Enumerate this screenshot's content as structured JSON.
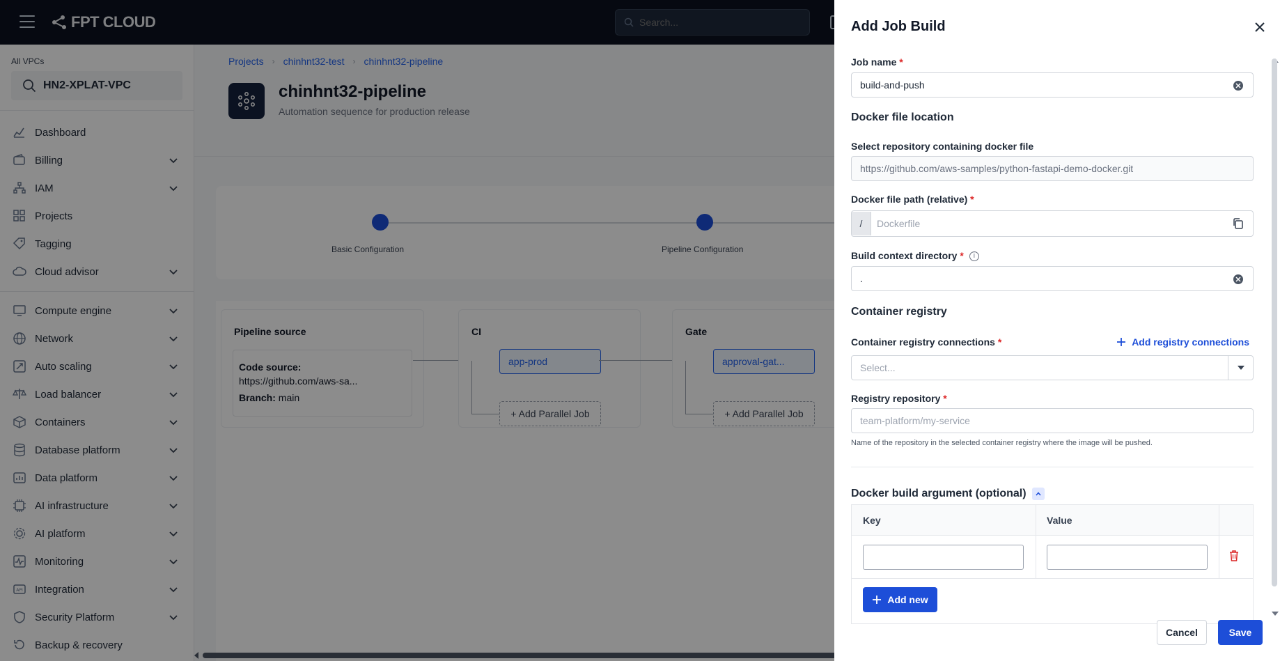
{
  "topbar": {
    "logo_text": "FPT CLOUD",
    "search_placeholder": "Search..."
  },
  "sidebar": {
    "vpc_label": "All VPCs",
    "vpc_value": "HN2-XPLAT-VPC",
    "items": [
      {
        "label": "Dashboard",
        "icon": "chart-icon",
        "expandable": false
      },
      {
        "label": "Billing",
        "icon": "wallet-icon",
        "expandable": true
      },
      {
        "label": "IAM",
        "icon": "org-icon",
        "expandable": true
      },
      {
        "label": "Projects",
        "icon": "grid-icon",
        "expandable": false
      },
      {
        "label": "Tagging",
        "icon": "tag-icon",
        "expandable": false
      },
      {
        "label": "Cloud advisor",
        "icon": "cloud-icon",
        "expandable": true
      },
      {
        "label": "Compute engine",
        "icon": "monitor-icon",
        "expandable": true
      },
      {
        "label": "Network",
        "icon": "globe-icon",
        "expandable": true
      },
      {
        "label": "Auto scaling",
        "icon": "scale-icon",
        "expandable": true
      },
      {
        "label": "Load balancer",
        "icon": "balance-icon",
        "expandable": true
      },
      {
        "label": "Containers",
        "icon": "box-icon",
        "expandable": true
      },
      {
        "label": "Database platform",
        "icon": "database-icon",
        "expandable": true
      },
      {
        "label": "Data platform",
        "icon": "data-icon",
        "expandable": true
      },
      {
        "label": "AI infrastructure",
        "icon": "ai-chip-icon",
        "expandable": true
      },
      {
        "label": "AI platform",
        "icon": "ai-gear-icon",
        "expandable": true
      },
      {
        "label": "Monitoring",
        "icon": "pulse-icon",
        "expandable": true
      },
      {
        "label": "Integration",
        "icon": "api-icon",
        "expandable": true
      },
      {
        "label": "Security Platform",
        "icon": "shield-icon",
        "expandable": true
      },
      {
        "label": "Backup & recovery",
        "icon": "backup-icon",
        "expandable": false
      }
    ]
  },
  "main": {
    "breadcrumb": [
      "Projects",
      "chinhnt32-test",
      "chinhnt32-pipeline"
    ],
    "title": "chinhnt32-pipeline",
    "subtitle": "Automation sequence for production release",
    "steps": [
      "Basic Configuration",
      "Pipeline Configuration"
    ],
    "stages": {
      "source_title": "Pipeline source",
      "code_source_label": "Code source:",
      "code_source_value": "https://github.com/aws-sa...",
      "branch_label": "Branch:",
      "branch_value": "main",
      "ci_title": "CI",
      "ci_job": "app-prod",
      "gate_title": "Gate",
      "gate_job": "approval-gat...",
      "add_parallel": "+ Add Parallel Job"
    }
  },
  "drawer": {
    "title": "Add Job Build",
    "job_name_label": "Job name",
    "job_name_value": "build-and-push",
    "docker_location_heading": "Docker file location",
    "repo_label": "Select repository containing docker file",
    "repo_value": "https://github.com/aws-samples/python-fastapi-demo-docker.git",
    "dockerfile_label": "Docker file path (relative)",
    "dockerfile_prefix": "/",
    "dockerfile_placeholder": "Dockerfile",
    "context_label": "Build context directory",
    "context_value": ".",
    "registry_heading": "Container registry",
    "registry_conn_label": "Container registry connections",
    "add_registry_label": "Add registry connections",
    "registry_conn_placeholder": "Select...",
    "registry_repo_label": "Registry repository",
    "registry_repo_placeholder": "team-platform/my-service",
    "registry_repo_hint": "Name of the repository in the selected container registry where the image will be pushed.",
    "build_args_heading": "Docker build argument (optional)",
    "key_header": "Key",
    "value_header": "Value",
    "add_new_label": "Add new",
    "cancel_label": "Cancel",
    "save_label": "Save"
  },
  "colors": {
    "primary": "#1d4ed8",
    "required": "#dc2626",
    "topbar": "#0b1220"
  }
}
